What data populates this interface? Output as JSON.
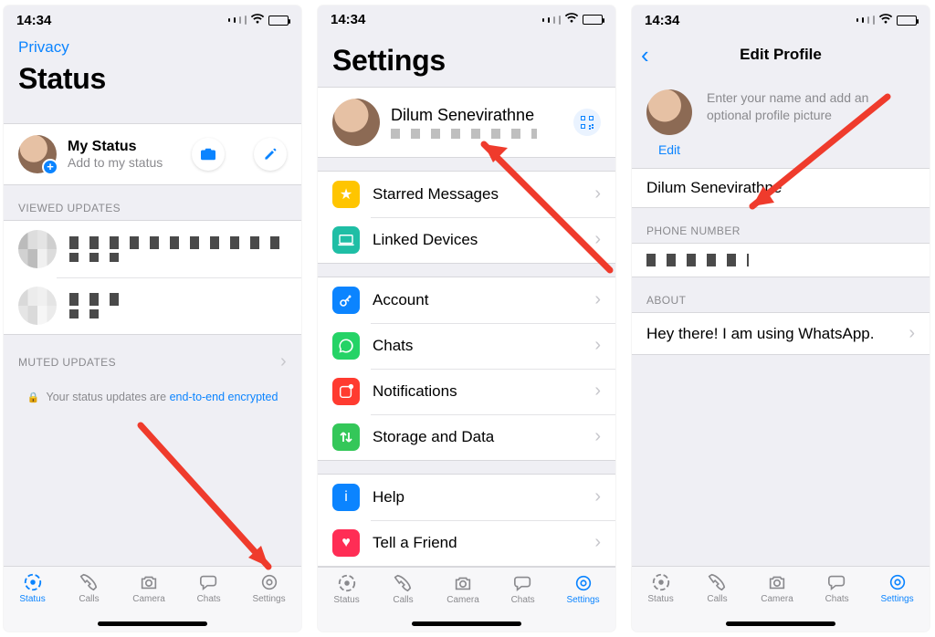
{
  "statusbar": {
    "time": "14:34"
  },
  "phone1": {
    "privacy_link": "Privacy",
    "title": "Status",
    "my_status": {
      "title": "My Status",
      "subtitle": "Add to my status"
    },
    "viewed_header": "VIEWED UPDATES",
    "muted_header": "MUTED UPDATES",
    "encryption_prefix": "Your status updates are ",
    "encryption_link": "end-to-end encrypted"
  },
  "phone2": {
    "title": "Settings",
    "profile_name": "Dilum Senevirathne",
    "items": {
      "starred": "Starred Messages",
      "linked": "Linked Devices",
      "account": "Account",
      "chats": "Chats",
      "notifications": "Notifications",
      "storage": "Storage and Data",
      "help": "Help",
      "taf": "Tell a Friend"
    }
  },
  "phone3": {
    "nav_title": "Edit Profile",
    "hint": "Enter your name and add an optional profile picture",
    "edit": "Edit",
    "name_value": "Dilum Senevirathne",
    "phone_header": "PHONE NUMBER",
    "about_header": "ABOUT",
    "about_value": "Hey there! I am using WhatsApp."
  },
  "tabs": {
    "status": "Status",
    "calls": "Calls",
    "camera": "Camera",
    "chats": "Chats",
    "settings": "Settings"
  },
  "icon_colors": {
    "starred": "#ffc500",
    "linked": "#1fbea5",
    "account": "#0b84ff",
    "chats": "#25d366",
    "notifications": "#ff3b30",
    "storage": "#34c759",
    "help": "#0b84ff",
    "taf": "#ff2d55"
  }
}
